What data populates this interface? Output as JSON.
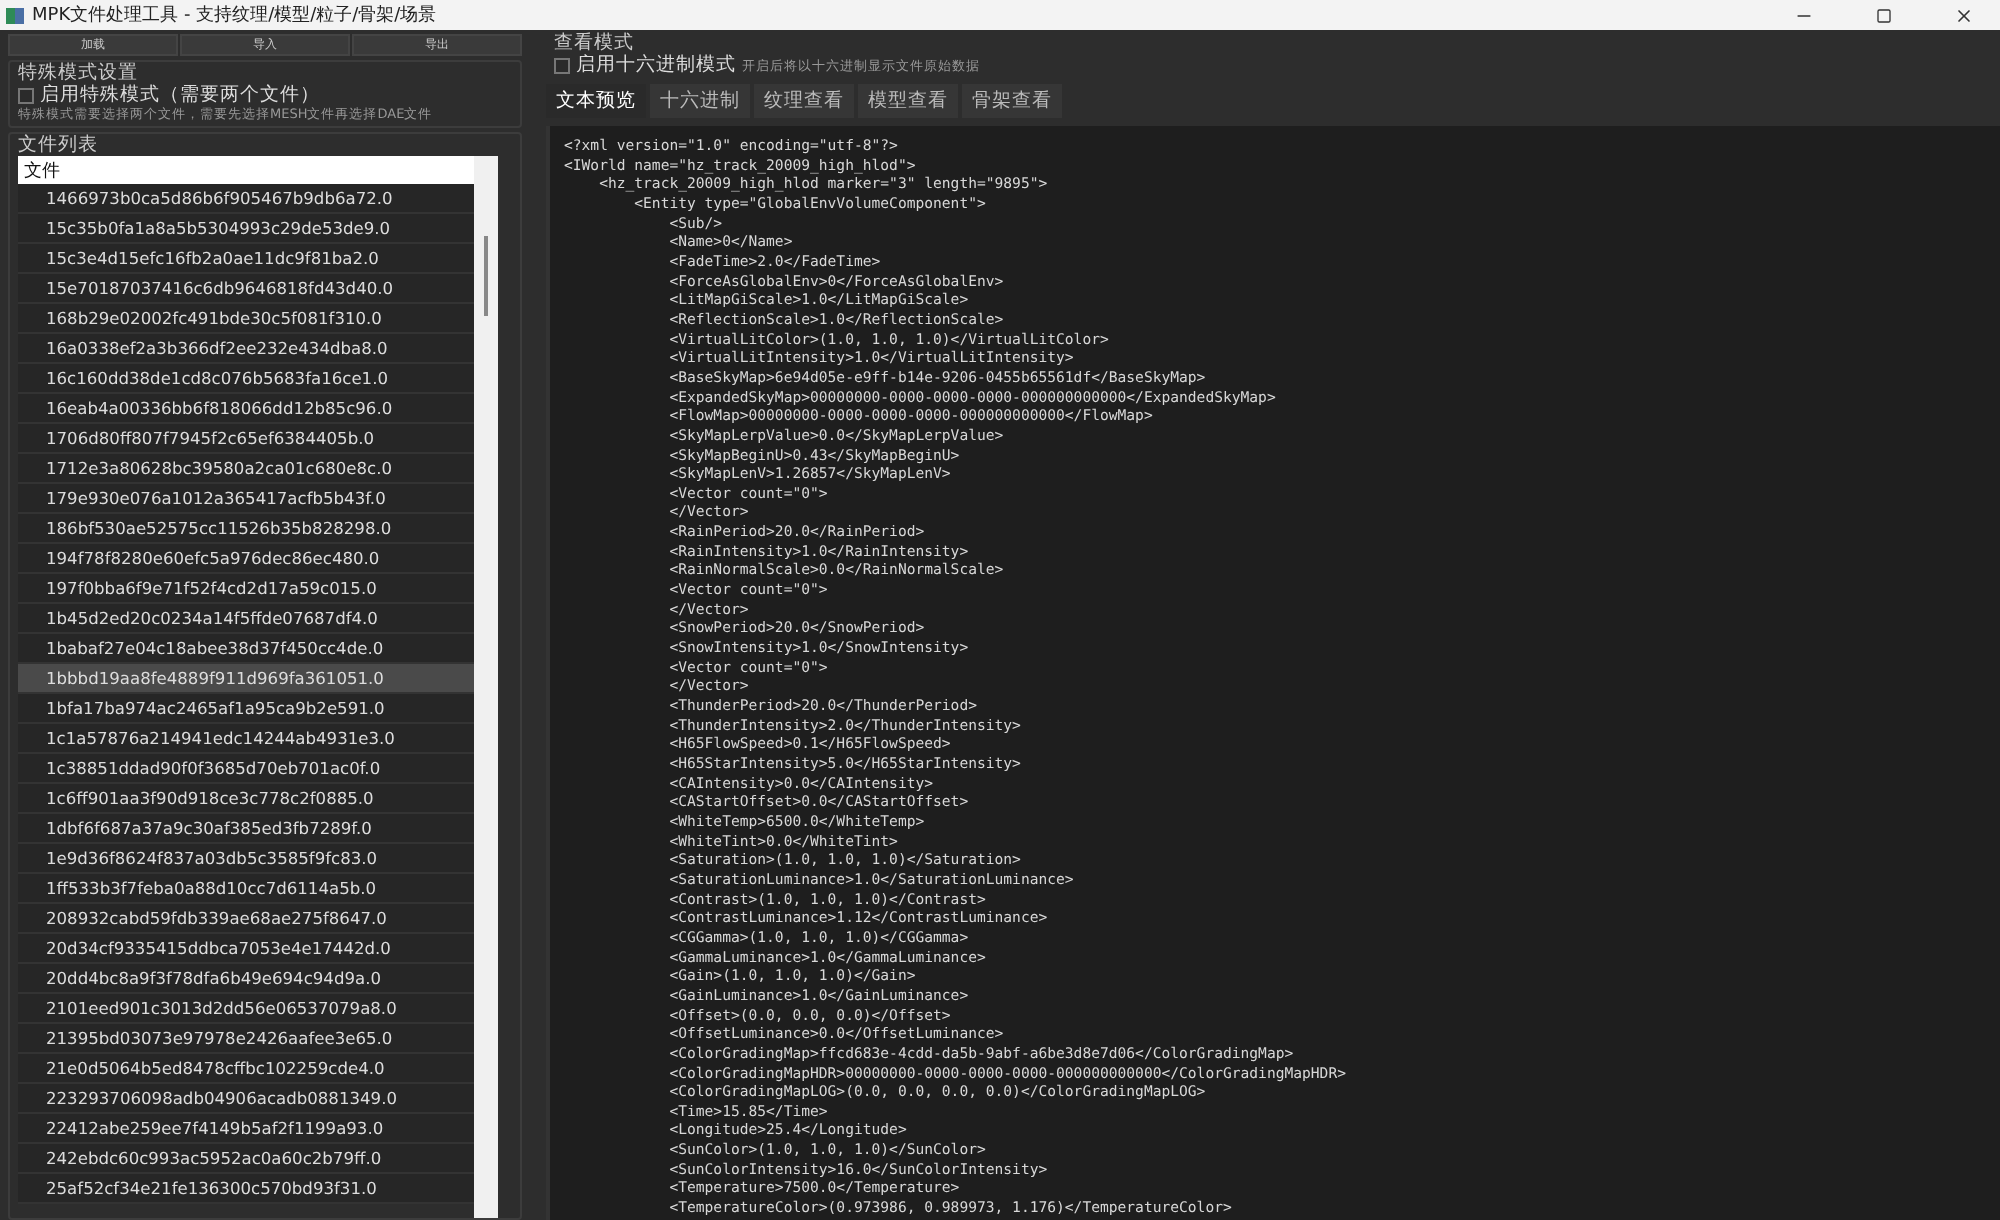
{
  "window": {
    "title": "MPK文件处理工具 - 支持纹理/模型/粒子/骨架/场景"
  },
  "toolbar": {
    "buttons": [
      "加载",
      "导入",
      "导出"
    ]
  },
  "special_mode": {
    "title": "特殊模式设置",
    "checkbox": {
      "label": "启用特殊模式（需要两个文件）",
      "checked": false
    },
    "hint": "特殊模式需要选择两个文件，需要先选择MESH文件再选择DAE文件"
  },
  "file_list": {
    "title": "文件列表",
    "header": "文件",
    "rows": [
      {
        "name": "1466973b0ca5d86b6f905467b9db6a72.0",
        "selected": false
      },
      {
        "name": "15c35b0fa1a8a5b5304993c29de53de9.0",
        "selected": false
      },
      {
        "name": "15c3e4d15efc16fb2a0ae11dc9f81ba2.0",
        "selected": false
      },
      {
        "name": "15e70187037416c6db9646818fd43d40.0",
        "selected": false
      },
      {
        "name": "168b29e02002fc491bde30c5f081f310.0",
        "selected": false
      },
      {
        "name": "16a0338ef2a3b366df2ee232e434dba8.0",
        "selected": false
      },
      {
        "name": "16c160dd38de1cd8c076b5683fa16ce1.0",
        "selected": false
      },
      {
        "name": "16eab4a00336bb6f818066dd12b85c96.0",
        "selected": false
      },
      {
        "name": "1706d80ff807f7945f2c65ef6384405b.0",
        "selected": false
      },
      {
        "name": "1712e3a80628bc39580a2ca01c680e8c.0",
        "selected": false
      },
      {
        "name": "179e930e076a1012a365417acfb5b43f.0",
        "selected": false
      },
      {
        "name": "186bf530ae52575cc11526b35b828298.0",
        "selected": false
      },
      {
        "name": "194f78f8280e60efc5a976dec86ec480.0",
        "selected": false
      },
      {
        "name": "197f0bba6f9e71f52f4cd2d17a59c015.0",
        "selected": false
      },
      {
        "name": "1b45d2ed20c0234a14f5ffde07687df4.0",
        "selected": false
      },
      {
        "name": "1babaf27e04c18abee38d37f450cc4de.0",
        "selected": false
      },
      {
        "name": "1bbbd19aa8fe4889f911d969fa361051.0",
        "selected": true
      },
      {
        "name": "1bfa17ba974ac2465af1a95ca9b2e591.0",
        "selected": false
      },
      {
        "name": "1c1a57876a214941edc14244ab4931e3.0",
        "selected": false
      },
      {
        "name": "1c38851ddad90f0f3685d70eb701ac0f.0",
        "selected": false
      },
      {
        "name": "1c6ff901aa3f90d918ce3c778c2f0885.0",
        "selected": false
      },
      {
        "name": "1dbf6f687a37a9c30af385ed3fb7289f.0",
        "selected": false
      },
      {
        "name": "1e9d36f8624f837a03db5c3585f9fc83.0",
        "selected": false
      },
      {
        "name": "1ff533b3f7feba0a88d10cc7d6114a5b.0",
        "selected": false
      },
      {
        "name": "208932cabd59fdb339ae68ae275f8647.0",
        "selected": false
      },
      {
        "name": "20d34cf9335415ddbca7053e4e17442d.0",
        "selected": false
      },
      {
        "name": "20dd4bc8a9f3f78dfa6b49e694c94d9a.0",
        "selected": false
      },
      {
        "name": "2101eed901c3013d2dd56e06537079a8.0",
        "selected": false
      },
      {
        "name": "21395bd03073e97978e2426aafee3e65.0",
        "selected": false
      },
      {
        "name": "21e0d5064b5ed8478cffbc102259cde4.0",
        "selected": false
      },
      {
        "name": "223293706098adb04906acadb0881349.0",
        "selected": false
      },
      {
        "name": "22412abe259ee7f4149b5af2f1199a93.0",
        "selected": false
      },
      {
        "name": "242ebdc60c993ac5952ac0a60c2b79ff.0",
        "selected": false
      },
      {
        "name": "25af52cf34e21fe136300c570bd93f31.0",
        "selected": false
      }
    ]
  },
  "view_mode": {
    "title": "查看模式",
    "checkbox": {
      "label": "启用十六进制模式",
      "checked": false
    },
    "hint": "开启后将以十六进制显示文件原始数据"
  },
  "tabs": [
    {
      "label": "文本预览",
      "selected": true
    },
    {
      "label": "十六进制",
      "selected": false
    },
    {
      "label": "纹理查看",
      "selected": false
    },
    {
      "label": "模型查看",
      "selected": false
    },
    {
      "label": "骨架查看",
      "selected": false
    }
  ],
  "preview_lines": [
    "<?xml version=\"1.0\" encoding=\"utf-8\"?>",
    "<IWorld name=\"hz_track_20009_high_hlod\">",
    "    <hz_track_20009_high_hlod marker=\"3\" length=\"9895\">",
    "        <Entity type=\"GlobalEnvVolumeComponent\">",
    "            <Sub/>",
    "            <Name>0</Name>",
    "            <FadeTime>2.0</FadeTime>",
    "            <ForceAsGlobalEnv>0</ForceAsGlobalEnv>",
    "            <LitMapGiScale>1.0</LitMapGiScale>",
    "            <ReflectionScale>1.0</ReflectionScale>",
    "            <VirtualLitColor>(1.0, 1.0, 1.0)</VirtualLitColor>",
    "            <VirtualLitIntensity>1.0</VirtualLitIntensity>",
    "            <BaseSkyMap>6e94d05e-e9ff-b14e-9206-0455b65561df</BaseSkyMap>",
    "            <ExpandedSkyMap>00000000-0000-0000-0000-000000000000</ExpandedSkyMap>",
    "            <FlowMap>00000000-0000-0000-0000-000000000000</FlowMap>",
    "            <SkyMapLerpValue>0.0</SkyMapLerpValue>",
    "            <SkyMapBeginU>0.43</SkyMapBeginU>",
    "            <SkyMapLenV>1.26857</SkyMapLenV>",
    "            <Vector count=\"0\">",
    "            </Vector>",
    "            <RainPeriod>20.0</RainPeriod>",
    "            <RainIntensity>1.0</RainIntensity>",
    "            <RainNormalScale>0.0</RainNormalScale>",
    "            <Vector count=\"0\">",
    "            </Vector>",
    "            <SnowPeriod>20.0</SnowPeriod>",
    "            <SnowIntensity>1.0</SnowIntensity>",
    "            <Vector count=\"0\">",
    "            </Vector>",
    "            <ThunderPeriod>20.0</ThunderPeriod>",
    "            <ThunderIntensity>2.0</ThunderIntensity>",
    "            <H65FlowSpeed>0.1</H65FlowSpeed>",
    "            <H65StarIntensity>5.0</H65StarIntensity>",
    "            <CAIntensity>0.0</CAIntensity>",
    "            <CAStartOffset>0.0</CAStartOffset>",
    "            <WhiteTemp>6500.0</WhiteTemp>",
    "            <WhiteTint>0.0</WhiteTint>",
    "            <Saturation>(1.0, 1.0, 1.0)</Saturation>",
    "            <SaturationLuminance>1.0</SaturationLuminance>",
    "            <Contrast>(1.0, 1.0, 1.0)</Contrast>",
    "            <ContrastLuminance>1.12</ContrastLuminance>",
    "            <CGGamma>(1.0, 1.0, 1.0)</CGGamma>",
    "            <GammaLuminance>1.0</GammaLuminance>",
    "            <Gain>(1.0, 1.0, 1.0)</Gain>",
    "            <GainLuminance>1.0</GainLuminance>",
    "            <Offset>(0.0, 0.0, 0.0)</Offset>",
    "            <OffsetLuminance>0.0</OffsetLuminance>",
    "            <ColorGradingMap>ffcd683e-4cdd-da5b-9abf-a6be3d8e7d06</ColorGradingMap>",
    "            <ColorGradingMapHDR>00000000-0000-0000-0000-000000000000</ColorGradingMapHDR>",
    "            <ColorGradingMapLOG>(0.0, 0.0, 0.0, 0.0)</ColorGradingMapLOG>",
    "            <Time>15.85</Time>",
    "            <Longitude>25.4</Longitude>",
    "            <SunColor>(1.0, 1.0, 1.0)</SunColor>",
    "            <SunColorIntensity>16.0</SunColorIntensity>",
    "            <Temperature>7500.0</Temperature>",
    "            <TemperatureColor>(0.973986, 0.989973, 1.176)</TemperatureColor>"
  ]
}
